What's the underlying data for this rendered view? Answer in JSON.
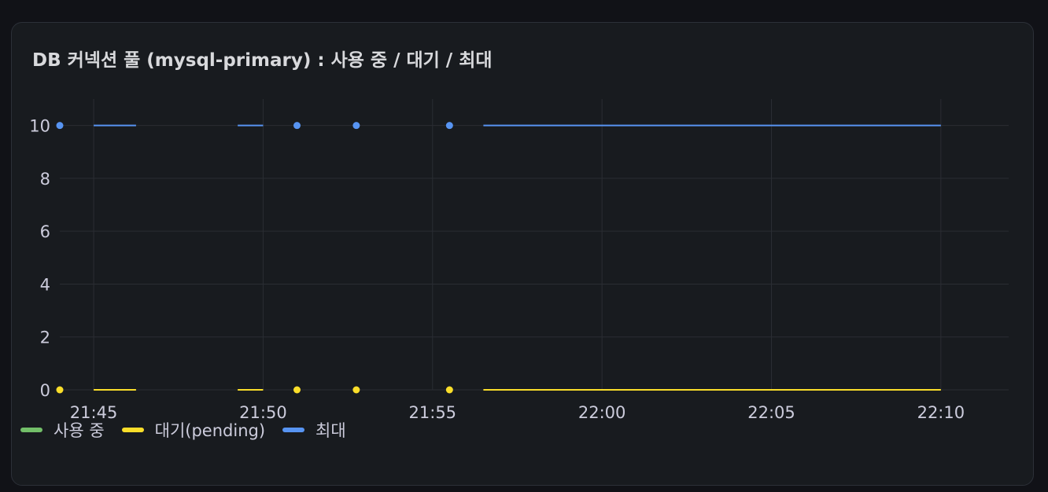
{
  "panel": {
    "title": "DB 커넥션 풀 (mysql-primary) : 사용 중 / 대기 / 최대"
  },
  "chart_data": {
    "type": "line",
    "x_unit": "time (HH:MM)",
    "xlim": [
      "21:44",
      "22:12"
    ],
    "ylim": [
      0,
      11
    ],
    "y_ticks": [
      0,
      2,
      4,
      6,
      8,
      10
    ],
    "x_ticks": [
      "21:45",
      "21:50",
      "21:55",
      "22:00",
      "22:05",
      "22:10"
    ],
    "grid": true,
    "legend_position": "bottom-left",
    "series": [
      {
        "name": "사용 중",
        "color": "#73bf69",
        "segments": []
      },
      {
        "name": "대기(pending)",
        "color": "#fade2a",
        "segments": [
          [
            [
              "21:45",
              0
            ],
            [
              "21:46.25",
              0
            ]
          ],
          [
            [
              "21:49.25",
              0
            ],
            [
              "21:50",
              0
            ]
          ],
          [
            [
              "21:56.5",
              0
            ],
            [
              "22:10",
              0
            ]
          ]
        ],
        "points": [
          [
            "21:44",
            0
          ],
          [
            "21:51",
            0
          ],
          [
            "21:52.75",
            0
          ],
          [
            "21:55.5",
            0
          ]
        ]
      },
      {
        "name": "최대",
        "color": "#5794f2",
        "segments": [
          [
            [
              "21:45",
              10
            ],
            [
              "21:46.25",
              10
            ]
          ],
          [
            [
              "21:49.25",
              10
            ],
            [
              "21:50",
              10
            ]
          ],
          [
            [
              "21:56.5",
              10
            ],
            [
              "22:10",
              10
            ]
          ]
        ],
        "points": [
          [
            "21:44",
            10
          ],
          [
            "21:51",
            10
          ],
          [
            "21:52.75",
            10
          ],
          [
            "21:55.5",
            10
          ]
        ]
      }
    ]
  }
}
